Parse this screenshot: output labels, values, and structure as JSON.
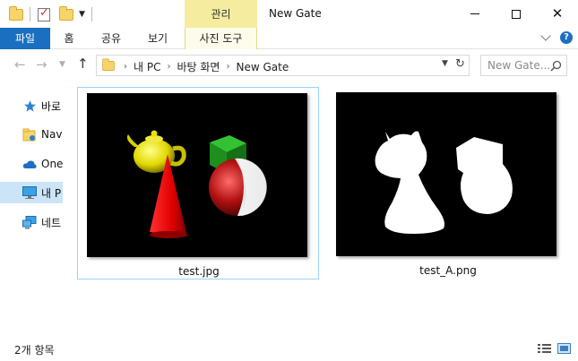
{
  "window": {
    "title": "New Gate",
    "contextual_group": "관리",
    "controls": [
      "minimize",
      "maximize",
      "close"
    ]
  },
  "quick_access": {
    "icons": [
      "folder-icon",
      "properties-check-icon",
      "new-folder-icon",
      "customize-dropdown-icon"
    ]
  },
  "ribbon": {
    "tabs": [
      {
        "id": "file",
        "label": "파일"
      },
      {
        "id": "home",
        "label": "홈"
      },
      {
        "id": "share",
        "label": "공유"
      },
      {
        "id": "view",
        "label": "보기"
      },
      {
        "id": "photo_tools",
        "label": "사진 도구"
      }
    ],
    "file_tab_color": "#1a6fc0",
    "contextual_color": "#f6eca0"
  },
  "address_bar": {
    "crumbs": [
      "내 PC",
      "바탕 화면",
      "New Gate"
    ]
  },
  "search": {
    "placeholder": "New Gate..."
  },
  "sidebar": {
    "items": [
      {
        "label": "바로",
        "icon": "star-icon"
      },
      {
        "label": "Nav",
        "icon": "folder-cloud-icon"
      },
      {
        "label": "One",
        "icon": "cloud-icon"
      },
      {
        "label": "내 P",
        "icon": "computer-icon",
        "selected": true
      },
      {
        "label": "네트",
        "icon": "network-icon"
      }
    ]
  },
  "files": [
    {
      "name": "test.jpg",
      "selected": true,
      "thumbnail": "rendered-3d-scene"
    },
    {
      "name": "test_A.png",
      "selected": false,
      "thumbnail": "alpha-mask"
    }
  ],
  "status": {
    "item_count": "2개 항목"
  }
}
